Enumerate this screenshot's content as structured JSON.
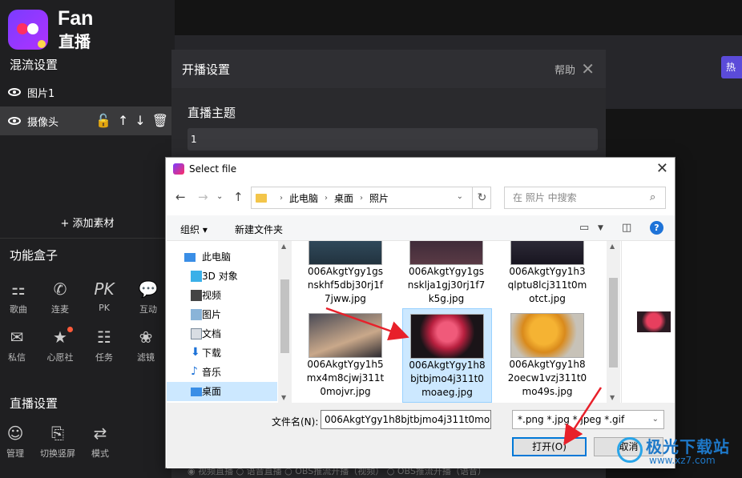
{
  "app": {
    "logo_text": "Fan",
    "logo_sub": "直播",
    "mix_title": "混流设置",
    "layers": [
      {
        "label": "图片1"
      },
      {
        "label": "摄像头"
      }
    ],
    "add_material": "+ 添加素材",
    "func_title": "功能盒子",
    "functions": [
      {
        "icon": "grid-icon",
        "glyph": "⚏",
        "label": "歌曲"
      },
      {
        "icon": "phone-icon",
        "glyph": "✆",
        "label": "连麦"
      },
      {
        "icon": "pk-icon",
        "glyph": "PK",
        "label": "PK"
      },
      {
        "icon": "chat-icon",
        "glyph": "💬",
        "label": "互动"
      },
      {
        "icon": "mail-icon",
        "glyph": "✉",
        "label": "私信"
      },
      {
        "icon": "star-icon",
        "glyph": "★",
        "label": "心愿社"
      },
      {
        "icon": "task-icon",
        "glyph": "☷",
        "label": "任务"
      },
      {
        "icon": "filter-icon",
        "glyph": "❀",
        "label": "滤镜"
      }
    ],
    "live_title": "直播设置",
    "live_items": [
      {
        "icon": "manage-icon",
        "glyph": "☺",
        "label": "管理"
      },
      {
        "icon": "rotate-icon",
        "glyph": "⎘",
        "label": "切换竖屏"
      },
      {
        "icon": "mode-icon",
        "glyph": "⇄",
        "label": "模式"
      }
    ],
    "hot_btn": "热"
  },
  "stream_dialog": {
    "title": "开播设置",
    "help": "帮助",
    "topic_label": "直播主题",
    "topic_value": "1",
    "bottom_text": "◉ 视频直播   ○ 语音直播   ○ OBS推流开播（视频）   ○ OBS推流开播（语音）"
  },
  "file_dialog": {
    "title": "Select file",
    "breadcrumb": [
      "此电脑",
      "桌面",
      "照片"
    ],
    "search_placeholder": "在 照片 中搜索",
    "toolbar": {
      "organize": "组织 ▾",
      "new_folder": "新建文件夹"
    },
    "tree": [
      {
        "label": "此电脑",
        "icon": "pc-icon",
        "top": true
      },
      {
        "label": "3D 对象",
        "icon": "cube-icon"
      },
      {
        "label": "视频",
        "icon": "video-icon"
      },
      {
        "label": "图片",
        "icon": "picture-icon"
      },
      {
        "label": "文档",
        "icon": "document-icon"
      },
      {
        "label": "下载",
        "icon": "download-icon"
      },
      {
        "label": "音乐",
        "icon": "music-icon"
      },
      {
        "label": "桌面",
        "icon": "desktop-icon",
        "selected": true
      }
    ],
    "files": [
      {
        "name": [
          "006AkgtYgy1gs",
          "nskhf5dbj30rj1f",
          "7jww.jpg"
        ]
      },
      {
        "name": [
          "006AkgtYgy1gs",
          "nsklja1gj30rj1f7",
          "k5g.jpg"
        ]
      },
      {
        "name": [
          "006AkgtYgy1h3",
          "qlptu8lcj311t0m",
          "otct.jpg"
        ]
      },
      {
        "name": [
          "006AkgtYgy1h5",
          "mx4m8cjwj311t",
          "0mojvr.jpg"
        ]
      },
      {
        "name": [
          "006AkgtYgy1h8",
          "bjtbjmo4j311t0",
          "moaeg.jpg"
        ],
        "selected": true
      },
      {
        "name": [
          "006AkgtYgy1h8",
          "2oecw1vzj311t0",
          "mo49s.jpg"
        ]
      }
    ],
    "filename_label": "文件名(N):",
    "filename_value": "006AkgtYgy1h8bjtbjmo4j311t0moa",
    "filter_value": "*.png *.jpg *.jpeg *.gif",
    "open_btn": "打开(O)",
    "cancel_btn": "取消"
  },
  "watermark": {
    "text": "极光下载站",
    "url": "www.xz7.com"
  }
}
